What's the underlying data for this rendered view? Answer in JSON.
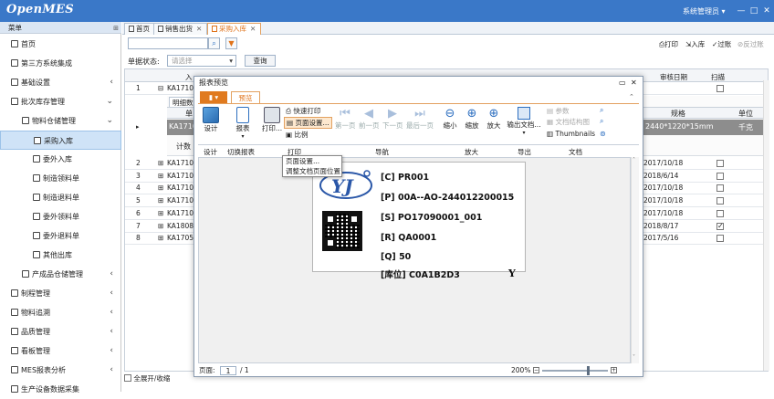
{
  "app": {
    "logo": "OpenMES",
    "user": "系统管理员 ▾"
  },
  "window_controls": [
    "—",
    "□",
    "✕"
  ],
  "sidebar": {
    "header": "菜单",
    "pin": "⊞",
    "items": [
      {
        "label": "首页",
        "level": 0,
        "arrow": ""
      },
      {
        "label": "第三方系统集成",
        "level": 0,
        "arrow": ""
      },
      {
        "label": "基础设置",
        "level": 0,
        "arrow": "‹"
      },
      {
        "label": "批次库存管理",
        "level": 0,
        "arrow": "⌄"
      },
      {
        "label": "物料仓储管理",
        "level": 1,
        "arrow": "⌄"
      },
      {
        "label": "采购入库",
        "level": 2,
        "arrow": "",
        "selected": true
      },
      {
        "label": "委外入库",
        "level": 2,
        "arrow": ""
      },
      {
        "label": "制造领料单",
        "level": 2,
        "arrow": ""
      },
      {
        "label": "制造退料单",
        "level": 2,
        "arrow": ""
      },
      {
        "label": "委外领料单",
        "level": 2,
        "arrow": ""
      },
      {
        "label": "委外退料单",
        "level": 2,
        "arrow": ""
      },
      {
        "label": "其他出库",
        "level": 2,
        "arrow": ""
      },
      {
        "label": "产成品仓储管理",
        "level": 1,
        "arrow": "‹"
      },
      {
        "label": "制程管理",
        "level": 0,
        "arrow": "‹"
      },
      {
        "label": "物料追溯",
        "level": 0,
        "arrow": "‹"
      },
      {
        "label": "品质管理",
        "level": 0,
        "arrow": "‹"
      },
      {
        "label": "看板管理",
        "level": 0,
        "arrow": "‹"
      },
      {
        "label": "MES报表分析",
        "level": 0,
        "arrow": "‹"
      },
      {
        "label": "生产设备数据采集",
        "level": 0,
        "arrow": ""
      }
    ]
  },
  "tabs": [
    {
      "label": "首页",
      "active": false
    },
    {
      "label": "销售出货",
      "active": false
    },
    {
      "label": "采购入库",
      "active": true
    }
  ],
  "toolbar": {
    "print": "打印",
    "in": "入库",
    "pass": "过账",
    "unpass": "反过账"
  },
  "filter": {
    "status_label": "单据状态:",
    "status_placeholder": "请选择",
    "query": "查询"
  },
  "grid": {
    "col_in": "入",
    "col_audit_date": "审核日期",
    "col_scan": "扫描",
    "col_spec": "规格",
    "col_unit": "单位",
    "sub_tab": "明细数",
    "sub_col": "单",
    "count_label": "计数",
    "row1_code": "KA1710",
    "expanded_code": "KA1710",
    "expanded_spec": "2440*1220*15mm",
    "expanded_unit": "千克",
    "rows": [
      {
        "no": "2",
        "code": "KA1710",
        "date": "2017/10/18",
        "checked": false
      },
      {
        "no": "3",
        "code": "KA1710",
        "date": "2018/6/14",
        "checked": false
      },
      {
        "no": "4",
        "code": "KA1710",
        "date": "2017/10/18",
        "checked": false
      },
      {
        "no": "5",
        "code": "KA1710",
        "date": "2017/10/18",
        "checked": false
      },
      {
        "no": "6",
        "code": "KA1710",
        "date": "2017/10/18",
        "checked": false
      },
      {
        "no": "7",
        "code": "KA1808",
        "date": "2018/8/17",
        "checked": true
      },
      {
        "no": "8",
        "code": "KA1705",
        "date": "2017/5/16",
        "checked": false
      }
    ]
  },
  "footer": {
    "expand_all": "全展开/收缩"
  },
  "dialog": {
    "title": "报表预览",
    "ribbon_tab": "预览",
    "btn_design": "设计",
    "btn_report": "报表",
    "btn_print": "打印...",
    "btn_quick_print": "快速打印",
    "btn_page_setup": "页面设置...",
    "btn_scale": "比例",
    "nav_first": "第一页",
    "nav_prev": "前一页",
    "nav_next": "下一页",
    "nav_last": "最后一页",
    "zoom_out": "缩小",
    "zoom": "缩放",
    "zoom_in": "放大",
    "export": "输出文档...",
    "param": "参数",
    "doc_struct": "文档结构图",
    "thumbnails": "Thumbnails",
    "groups": {
      "design": "设计",
      "switch": "切换报表",
      "print": "打印",
      "nav": "导航",
      "zoom": "放大",
      "export": "导出",
      "doc": "文档"
    },
    "context_menu": [
      "页面设置...",
      "调整文档页面位置"
    ],
    "label": {
      "c": "[C] PR001",
      "p": "[P] 00A--AO-244012200015",
      "s": "[S] PO17090001_001",
      "r": "[R] QA0001",
      "q": "[Q] 50",
      "loc": "[库位] C0A1B2D3",
      "y": "Y"
    },
    "page_label": "页面:",
    "page_value": "1",
    "page_total": "/ 1",
    "zoom_level": "200%",
    "zoom_fraction": 0.7
  }
}
